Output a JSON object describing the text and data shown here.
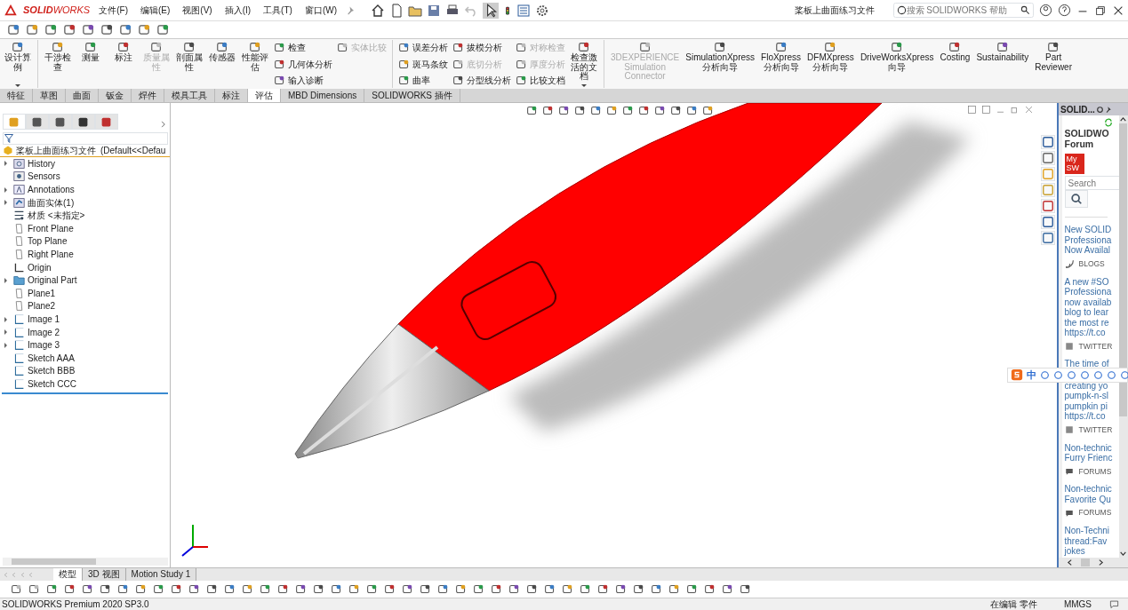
{
  "title_bar": {
    "logo": "**SOLID**WORKS",
    "menus": [
      "文件(F)",
      "编辑(E)",
      "视图(V)",
      "插入(I)",
      "工具(T)",
      "窗口(W)"
    ],
    "document_title": "桨板上曲面练习文件",
    "search": {
      "placeholder": "搜索 SOLIDWORKS 帮助"
    }
  },
  "ribbon": [
    {
      "kind": "large",
      "label": "设计算例",
      "disabled": false,
      "caret": true
    },
    {
      "kind": "separator"
    },
    {
      "kind": "large",
      "label": "干涉检查",
      "disabled": false,
      "caret": false
    },
    {
      "kind": "large",
      "label": "测量",
      "disabled": false,
      "caret": false
    },
    {
      "kind": "large",
      "label": "标注",
      "disabled": false,
      "caret": false
    },
    {
      "kind": "large",
      "label": "质量属性",
      "disabled": true,
      "caret": false
    },
    {
      "kind": "large",
      "label": "剖面属性",
      "disabled": false,
      "caret": false
    },
    {
      "kind": "large",
      "label": "传感器",
      "disabled": false,
      "caret": false
    },
    {
      "kind": "large",
      "label": "性能评估",
      "disabled": false,
      "caret": false
    },
    {
      "kind": "stack",
      "items": [
        {
          "label": "检查",
          "disabled": false
        },
        {
          "label": "几何体分析",
          "disabled": false
        },
        {
          "label": "输入诊断",
          "disabled": false
        }
      ]
    },
    {
      "kind": "stack",
      "items": [
        {
          "label": "实体比较",
          "disabled": true
        }
      ]
    },
    {
      "kind": "separator"
    },
    {
      "kind": "stack",
      "items": [
        {
          "label": "误差分析",
          "disabled": false
        },
        {
          "label": "斑马条纹",
          "disabled": false
        },
        {
          "label": "曲率",
          "disabled": false
        }
      ]
    },
    {
      "kind": "stack",
      "items": [
        {
          "label": "拔模分析",
          "disabled": false
        },
        {
          "label": "底切分析",
          "disabled": true
        },
        {
          "label": "分型线分析",
          "disabled": false
        }
      ]
    },
    {
      "kind": "stack",
      "items": [
        {
          "label": "对称检查",
          "disabled": true
        },
        {
          "label": "厚度分析",
          "disabled": true
        },
        {
          "label": "比较文档",
          "disabled": false
        }
      ]
    },
    {
      "kind": "large",
      "label": "检查激活的文档",
      "disabled": false,
      "caret": true
    },
    {
      "kind": "separator"
    },
    {
      "kind": "large",
      "label": "3DEXPERIENCE Simulation Connector",
      "disabled": true,
      "caret": false
    },
    {
      "kind": "large",
      "label": "SimulationXpress 分析向导",
      "disabled": false,
      "caret": false
    },
    {
      "kind": "large",
      "label": "FloXpress 分析向导",
      "disabled": false,
      "caret": false
    },
    {
      "kind": "large",
      "label": "DFMXpress 分析向导",
      "disabled": false,
      "caret": false
    },
    {
      "kind": "large",
      "label": "DriveWorksXpress 向导",
      "disabled": false,
      "caret": false
    },
    {
      "kind": "large",
      "label": "Costing",
      "disabled": false,
      "caret": false
    },
    {
      "kind": "large",
      "label": "Sustainability",
      "disabled": false,
      "caret": false
    },
    {
      "kind": "large",
      "label": "Part Reviewer",
      "disabled": false,
      "caret": false
    }
  ],
  "command_tabs": [
    {
      "label": "特征",
      "selected": false
    },
    {
      "label": "草图",
      "selected": false
    },
    {
      "label": "曲面",
      "selected": false
    },
    {
      "label": "钣金",
      "selected": false
    },
    {
      "label": "焊件",
      "selected": false
    },
    {
      "label": "模具工具",
      "selected": false
    },
    {
      "label": "标注",
      "selected": false
    },
    {
      "label": "评估",
      "selected": true
    },
    {
      "label": "MBD Dimensions",
      "selected": false
    },
    {
      "label": "SOLIDWORKS 插件",
      "selected": false
    }
  ],
  "feature_tree": {
    "panel_tabs": [
      {
        "selected": true
      },
      {
        "selected": false
      },
      {
        "selected": false
      },
      {
        "selected": false
      },
      {
        "selected": false
      }
    ],
    "root_label": "桨板上曲面练习文件",
    "root_config": "(Default<<Defau",
    "items": [
      {
        "label": "History",
        "kind": "history",
        "expandable": true
      },
      {
        "label": "Sensors",
        "kind": "sensors",
        "expandable": false
      },
      {
        "label": "Annotations",
        "kind": "annotations",
        "expandable": true
      },
      {
        "label": "曲面实体(1)",
        "kind": "solid",
        "expandable": true
      },
      {
        "label": "材质 <未指定>",
        "kind": "material",
        "expandable": false
      },
      {
        "label": "Front Plane",
        "kind": "plane",
        "expandable": false
      },
      {
        "label": "Top Plane",
        "kind": "plane",
        "expandable": false
      },
      {
        "label": "Right Plane",
        "kind": "plane",
        "expandable": false
      },
      {
        "label": "Origin",
        "kind": "origin",
        "expandable": false
      },
      {
        "label": "Original Part",
        "kind": "folder",
        "expandable": true
      },
      {
        "label": "Plane1",
        "kind": "plane",
        "expandable": false
      },
      {
        "label": "Plane2",
        "kind": "plane",
        "expandable": false
      },
      {
        "label": "Image 1",
        "kind": "sketch",
        "expandable": true
      },
      {
        "label": "Image 2",
        "kind": "sketch",
        "expandable": true
      },
      {
        "label": "Image 3",
        "kind": "sketch",
        "expandable": true
      },
      {
        "label": "Sketch AAA",
        "kind": "sketch",
        "expandable": false
      },
      {
        "label": "Sketch BBB",
        "kind": "sketch",
        "expandable": false
      },
      {
        "label": "Sketch CCC",
        "kind": "sketch",
        "expandable": false
      }
    ]
  },
  "task_pane": {
    "title": "SOLID...",
    "heading": [
      "SOLIDWO",
      "Forum"
    ],
    "logo": "My SW",
    "search": {
      "placeholder": "Search"
    },
    "posts": [
      {
        "lines": [
          "New SOLID",
          "Professiona",
          "Now Availal"
        ],
        "tag": "BLOGS",
        "kind": "blog"
      },
      {
        "lines": [
          "A new #SO",
          "Professiona",
          "now availab",
          "blog to lear",
          "the most re",
          "https://t.co"
        ],
        "tag": "TWITTER",
        "kind": "twitter"
      },
      {
        "lines": [
          "The time of"
        ],
        "lines_below_ime_bar": [
          "creating yo",
          "pumpk-n-sl",
          "pumpkin pi",
          "https://t.co"
        ],
        "tag": "TWITTER",
        "kind": "twitter"
      },
      {
        "lines": [
          "Non-technic",
          "Furry Frienc"
        ],
        "tag": "FORUMS",
        "kind": "forum"
      },
      {
        "lines": [
          "Non-technic",
          "Favorite Qu"
        ],
        "tag": "FORUMS",
        "kind": "forum"
      },
      {
        "lines": [
          "Non-Techni",
          "thread:Fav",
          "jokes"
        ]
      }
    ]
  },
  "ime_bar": {
    "label": "中"
  },
  "bottom_tabs": [
    {
      "label": "模型",
      "selected": true
    },
    {
      "label": "3D 视图",
      "selected": false
    },
    {
      "label": "Motion Study 1",
      "selected": false
    }
  ],
  "status_bar": {
    "product": "SOLIDWORKS Premium 2020 SP3.0",
    "mode": "在编辑 零件",
    "units": "MMGS"
  }
}
